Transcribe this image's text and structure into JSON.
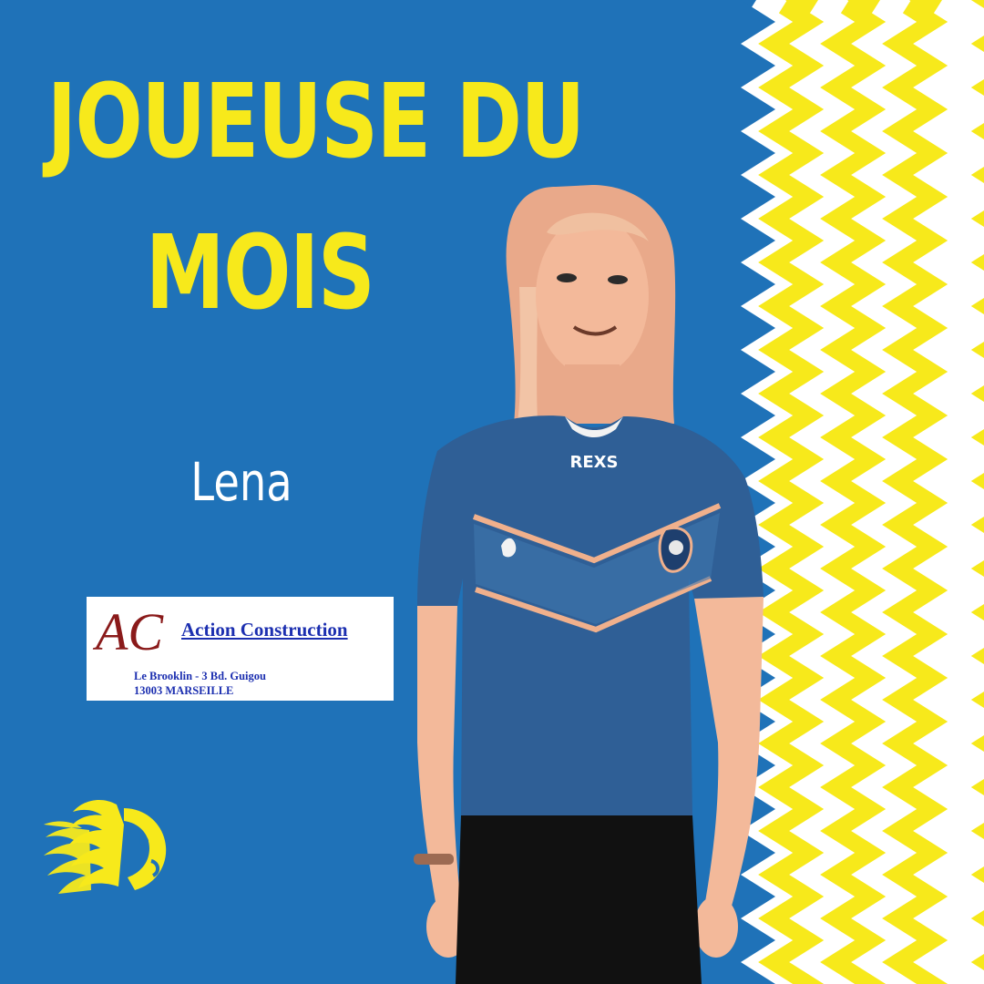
{
  "colors": {
    "background": "#1f72b8",
    "accent_yellow": "#f7e91b",
    "zigzag_white": "#ffffff",
    "sponsor_text": "#1c2fb0",
    "sponsor_logo": "#8a1a1a"
  },
  "title": {
    "line1": "JOUEUSE DU",
    "line2": "MOIS"
  },
  "player": {
    "name": "Lena",
    "jersey_brand": "REXS"
  },
  "sponsor": {
    "logo_letters": "AC",
    "name": "Action Construction",
    "address_line1": "Le Brooklin - 3 Bd. Guigou",
    "address_line2": "13003 MARSEILLE"
  },
  "icons": {
    "club_logo": "lion-head-icon",
    "decor": "zigzag-pattern"
  }
}
